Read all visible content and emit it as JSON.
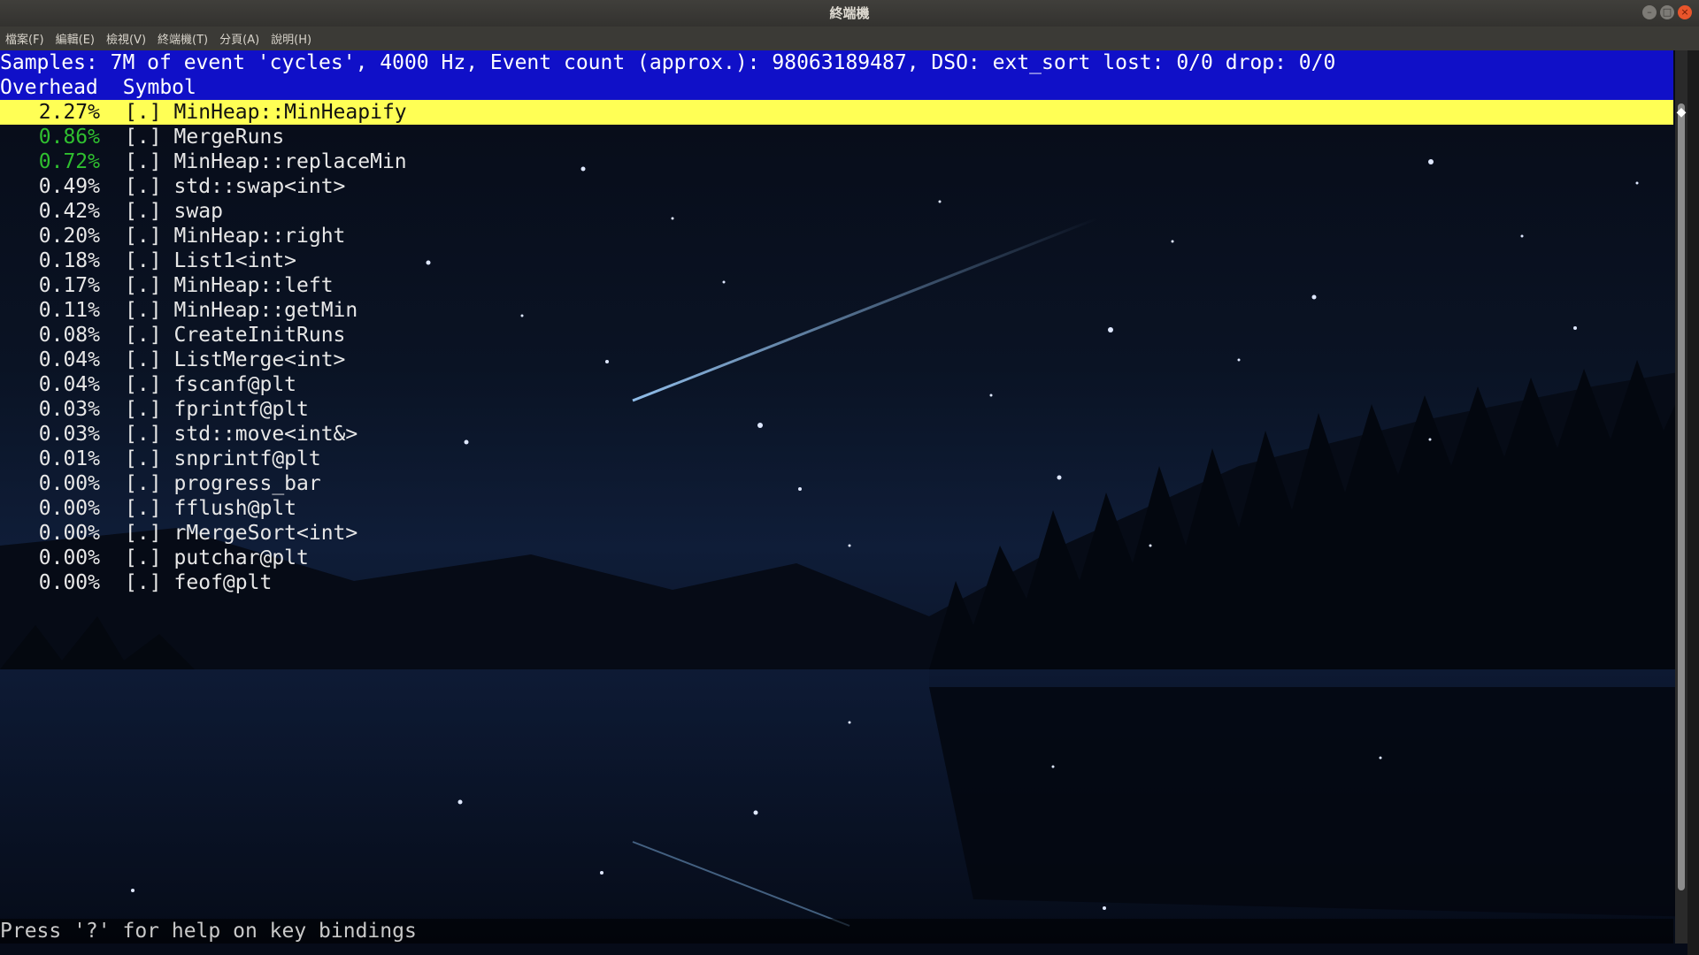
{
  "window": {
    "title": "終端機",
    "buttons": {
      "minimize": "–",
      "maximize": "□",
      "close": "×"
    }
  },
  "menubar": [
    "檔案(F)",
    "編輯(E)",
    "檢視(V)",
    "終端機(T)",
    "分頁(A)",
    "說明(H)"
  ],
  "perf": {
    "header": "Samples: 7M of event 'cycles', 4000 Hz, Event count (approx.): 98063189487, DSO: ext_sort lost: 0/0 drop: 0/0",
    "columns": {
      "overhead": "Overhead",
      "symbol": "Symbol"
    },
    "rows": [
      {
        "overhead": "2.27%",
        "dso": "[.]",
        "symbol": "MinHeap::MinHeapify",
        "selected": true,
        "color": "default"
      },
      {
        "overhead": "0.86%",
        "dso": "[.]",
        "symbol": "MergeRuns",
        "selected": false,
        "color": "green"
      },
      {
        "overhead": "0.72%",
        "dso": "[.]",
        "symbol": "MinHeap::replaceMin",
        "selected": false,
        "color": "green"
      },
      {
        "overhead": "0.49%",
        "dso": "[.]",
        "symbol": "std::swap<int>",
        "selected": false,
        "color": "default"
      },
      {
        "overhead": "0.42%",
        "dso": "[.]",
        "symbol": "swap",
        "selected": false,
        "color": "default"
      },
      {
        "overhead": "0.20%",
        "dso": "[.]",
        "symbol": "MinHeap::right",
        "selected": false,
        "color": "default"
      },
      {
        "overhead": "0.18%",
        "dso": "[.]",
        "symbol": "List1<int>",
        "selected": false,
        "color": "default"
      },
      {
        "overhead": "0.17%",
        "dso": "[.]",
        "symbol": "MinHeap::left",
        "selected": false,
        "color": "default"
      },
      {
        "overhead": "0.11%",
        "dso": "[.]",
        "symbol": "MinHeap::getMin",
        "selected": false,
        "color": "default"
      },
      {
        "overhead": "0.08%",
        "dso": "[.]",
        "symbol": "CreateInitRuns",
        "selected": false,
        "color": "default"
      },
      {
        "overhead": "0.04%",
        "dso": "[.]",
        "symbol": "ListMerge<int>",
        "selected": false,
        "color": "default"
      },
      {
        "overhead": "0.04%",
        "dso": "[.]",
        "symbol": "fscanf@plt",
        "selected": false,
        "color": "default"
      },
      {
        "overhead": "0.03%",
        "dso": "[.]",
        "symbol": "fprintf@plt",
        "selected": false,
        "color": "default"
      },
      {
        "overhead": "0.03%",
        "dso": "[.]",
        "symbol": "std::move<int&>",
        "selected": false,
        "color": "default"
      },
      {
        "overhead": "0.01%",
        "dso": "[.]",
        "symbol": "snprintf@plt",
        "selected": false,
        "color": "default"
      },
      {
        "overhead": "0.00%",
        "dso": "[.]",
        "symbol": "progress_bar",
        "selected": false,
        "color": "default"
      },
      {
        "overhead": "0.00%",
        "dso": "[.]",
        "symbol": "fflush@plt",
        "selected": false,
        "color": "default"
      },
      {
        "overhead": "0.00%",
        "dso": "[.]",
        "symbol": "rMergeSort<int>",
        "selected": false,
        "color": "default"
      },
      {
        "overhead": "0.00%",
        "dso": "[.]",
        "symbol": "putchar@plt",
        "selected": false,
        "color": "default"
      },
      {
        "overhead": "0.00%",
        "dso": "[.]",
        "symbol": "feof@plt",
        "selected": false,
        "color": "default"
      }
    ],
    "status": "Press '?' for help on key bindings"
  },
  "colors": {
    "header_bg": "#1010c8",
    "selected_bg": "#ffff55",
    "green_text": "#2fbf2f",
    "close_button": "#e9552b"
  },
  "icons": [
    "minimize-icon",
    "maximize-icon",
    "close-icon"
  ]
}
